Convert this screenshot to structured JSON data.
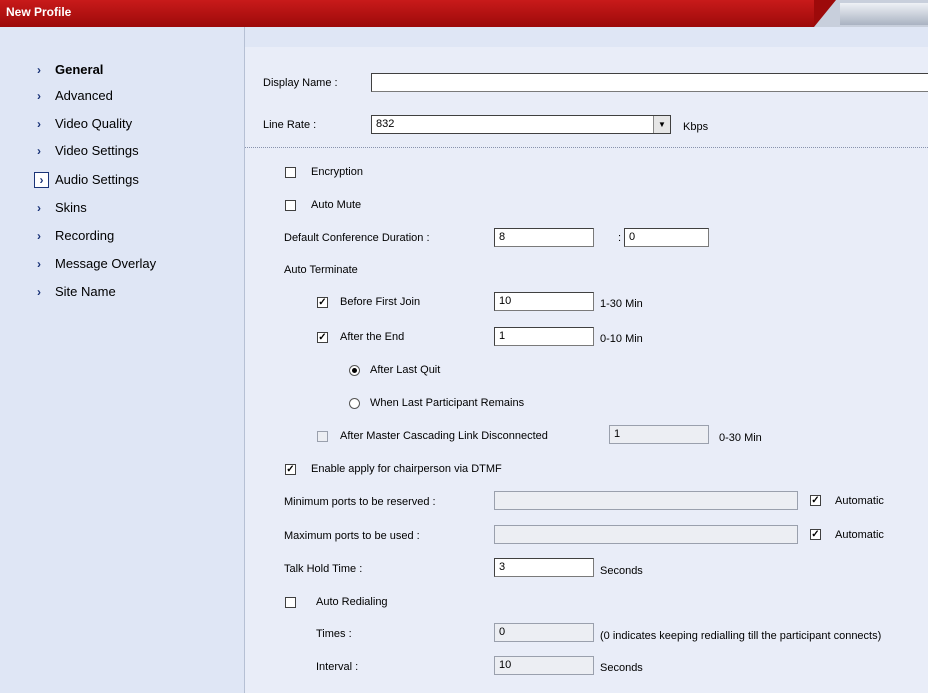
{
  "window": {
    "title": "New Profile"
  },
  "sidebar": {
    "items": [
      {
        "label": "General"
      },
      {
        "label": "Advanced"
      },
      {
        "label": "Video Quality"
      },
      {
        "label": "Video Settings"
      },
      {
        "label": "Audio Settings"
      },
      {
        "label": "Skins"
      },
      {
        "label": "Recording"
      },
      {
        "label": "Message Overlay"
      },
      {
        "label": "Site Name"
      }
    ]
  },
  "form": {
    "display_name": {
      "label": "Display Name :",
      "value": ""
    },
    "line_rate": {
      "label": "Line Rate :",
      "value": "832",
      "unit": "Kbps"
    },
    "encryption": {
      "label": "Encryption",
      "checked": false
    },
    "auto_mute": {
      "label": "Auto Mute",
      "checked": false
    },
    "duration": {
      "label": "Default Conference Duration :",
      "hours": "8",
      "sep": ":",
      "minutes": "0"
    },
    "auto_terminate": {
      "label": "Auto Terminate",
      "before_first_join": {
        "label": "Before First Join",
        "checked": true,
        "value": "10",
        "range": "1-30 Min"
      },
      "after_the_end": {
        "label": "After the End",
        "checked": true,
        "value": "1",
        "range": "0-10 Min"
      },
      "after_last_quit": {
        "label": "After Last Quit",
        "selected": true
      },
      "when_last_participant": {
        "label": "When Last Participant Remains",
        "selected": false
      },
      "master_cascading": {
        "label": "After Master Cascading Link Disconnected",
        "checked": false,
        "value": "1",
        "range": "0-30 Min"
      }
    },
    "chairperson_dtmf": {
      "label": "Enable apply for chairperson via DTMF",
      "checked": true
    },
    "min_ports": {
      "label": "Minimum ports to be reserved :",
      "value": "",
      "auto_label": "Automatic",
      "auto_checked": true
    },
    "max_ports": {
      "label": "Maximum ports to be used :",
      "value": "",
      "auto_label": "Automatic",
      "auto_checked": true
    },
    "talk_hold": {
      "label": "Talk Hold Time :",
      "value": "3",
      "unit": "Seconds"
    },
    "auto_redialing": {
      "label": "Auto Redialing",
      "checked": false
    },
    "times": {
      "label": "Times :",
      "value": "0",
      "note": "(0 indicates keeping redialling till the participant connects)"
    },
    "interval": {
      "label": "Interval :",
      "value": "10",
      "unit": "Seconds"
    }
  },
  "glyphs": {
    "chevron": "›",
    "check": "✓",
    "dropdown": "▼"
  }
}
